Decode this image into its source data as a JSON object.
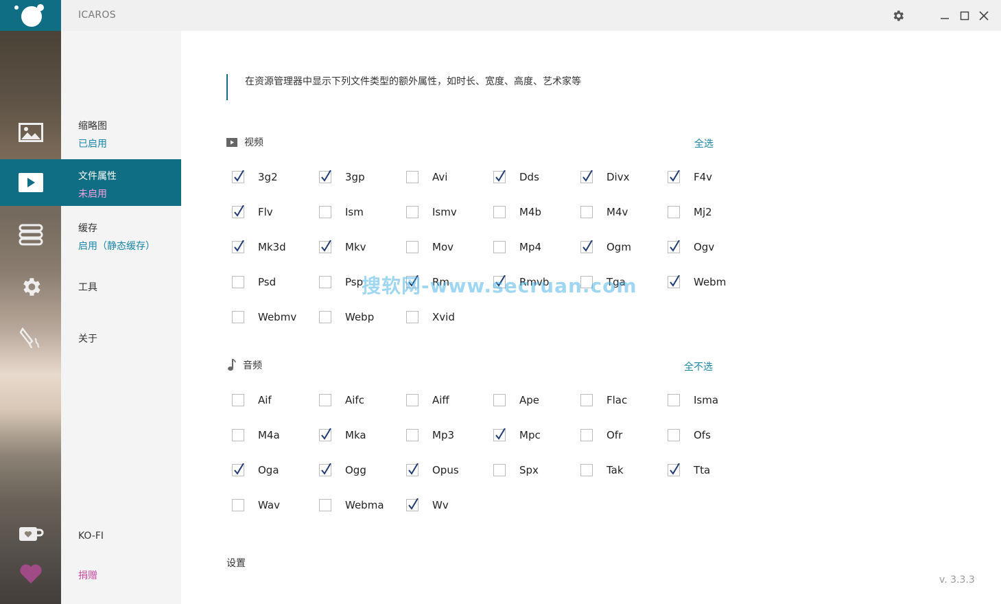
{
  "window": {
    "title": "ICAROS"
  },
  "nav": {
    "items": [
      {
        "title": "缩略图",
        "status": "已启用"
      },
      {
        "title": "文件属性",
        "status": "未启用"
      },
      {
        "title": "缓存",
        "status": "启用（静态缓存）"
      },
      {
        "title": "工具"
      },
      {
        "title": "关于"
      }
    ],
    "kofi": "KO-FI",
    "donate": "捐赠"
  },
  "main": {
    "description": "在资源管理器中显示下列文件类型的额外属性，如时长、宽度、高度、艺术家等",
    "video": {
      "label": "视频",
      "select_toggle": "全选",
      "items": [
        {
          "name": "3g2",
          "checked": true
        },
        {
          "name": "3gp",
          "checked": true
        },
        {
          "name": "Avi",
          "checked": false
        },
        {
          "name": "Dds",
          "checked": true
        },
        {
          "name": "Divx",
          "checked": true
        },
        {
          "name": "F4v",
          "checked": true
        },
        {
          "name": "Flv",
          "checked": true
        },
        {
          "name": "Ism",
          "checked": false
        },
        {
          "name": "Ismv",
          "checked": false
        },
        {
          "name": "M4b",
          "checked": false
        },
        {
          "name": "M4v",
          "checked": false
        },
        {
          "name": "Mj2",
          "checked": false
        },
        {
          "name": "Mk3d",
          "checked": true
        },
        {
          "name": "Mkv",
          "checked": true
        },
        {
          "name": "Mov",
          "checked": false
        },
        {
          "name": "Mp4",
          "checked": false
        },
        {
          "name": "Ogm",
          "checked": true
        },
        {
          "name": "Ogv",
          "checked": true
        },
        {
          "name": "Psd",
          "checked": false
        },
        {
          "name": "Psp",
          "checked": false
        },
        {
          "name": "Rm",
          "checked": true
        },
        {
          "name": "Rmvb",
          "checked": true
        },
        {
          "name": "Tga",
          "checked": false
        },
        {
          "name": "Webm",
          "checked": true
        },
        {
          "name": "Webmv",
          "checked": false
        },
        {
          "name": "Webp",
          "checked": false
        },
        {
          "name": "Xvid",
          "checked": false
        }
      ]
    },
    "audio": {
      "label": "音频",
      "select_toggle": "全不选",
      "items": [
        {
          "name": "Aif",
          "checked": false
        },
        {
          "name": "Aifc",
          "checked": false
        },
        {
          "name": "Aiff",
          "checked": false
        },
        {
          "name": "Ape",
          "checked": false
        },
        {
          "name": "Flac",
          "checked": false
        },
        {
          "name": "Isma",
          "checked": false
        },
        {
          "name": "M4a",
          "checked": false
        },
        {
          "name": "Mka",
          "checked": true
        },
        {
          "name": "Mp3",
          "checked": false
        },
        {
          "name": "Mpc",
          "checked": true
        },
        {
          "name": "Ofr",
          "checked": false
        },
        {
          "name": "Ofs",
          "checked": false
        },
        {
          "name": "Oga",
          "checked": true
        },
        {
          "name": "Ogg",
          "checked": true
        },
        {
          "name": "Opus",
          "checked": true
        },
        {
          "name": "Spx",
          "checked": false
        },
        {
          "name": "Tak",
          "checked": false
        },
        {
          "name": "Tta",
          "checked": true
        },
        {
          "name": "Wav",
          "checked": false
        },
        {
          "name": "Webma",
          "checked": false
        },
        {
          "name": "Wv",
          "checked": true
        }
      ]
    },
    "settings_label": "设置",
    "version": "v. 3.3.3",
    "watermark": "搜软网-www.secruan.com"
  },
  "colors": {
    "accent": "#0f6e84",
    "link": "#1a86a8",
    "inactive_status": "#f6a0e0",
    "donate": "#c34aa0"
  }
}
